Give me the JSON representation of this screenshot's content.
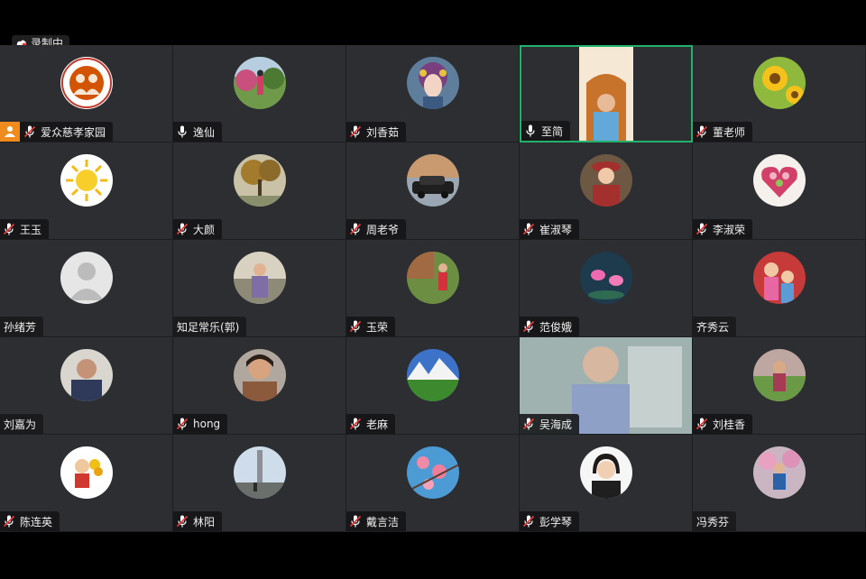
{
  "recording": {
    "label": "录制中"
  },
  "colors": {
    "tile_bg": "#2d2e31",
    "active_border": "#23b26b",
    "host_badge": "#f08c1e",
    "muted_red": "#e33b3b"
  },
  "participants": [
    {
      "name": "爱众慈孝家园",
      "mic": "muted",
      "host": true,
      "avatar": "logo"
    },
    {
      "name": "逸仙",
      "mic": "on",
      "avatar": "garden-photo"
    },
    {
      "name": "刘香茹",
      "mic": "muted",
      "avatar": "opera-mask"
    },
    {
      "name": "至简",
      "mic": "on",
      "active": true,
      "avatar": "portrait"
    },
    {
      "name": "董老师",
      "mic": "muted",
      "avatar": "sunflower"
    },
    {
      "name": "王玉",
      "mic": "muted",
      "avatar": "sun-drawing"
    },
    {
      "name": "大颜",
      "mic": "muted",
      "avatar": "autumn-tree"
    },
    {
      "name": "周老爷",
      "mic": "muted",
      "avatar": "car"
    },
    {
      "name": "崔淑琴",
      "mic": "muted",
      "avatar": "woman-hat"
    },
    {
      "name": "李淑荣",
      "mic": "muted",
      "avatar": "flower-heart"
    },
    {
      "name": "孙绪芳",
      "mic": "none",
      "avatar": "default"
    },
    {
      "name": "知足常乐(郭)",
      "mic": "none",
      "avatar": "woman-outdoor"
    },
    {
      "name": "玉荣",
      "mic": "muted",
      "avatar": "garden-woman"
    },
    {
      "name": "范俊娥",
      "mic": "muted",
      "avatar": "lotus"
    },
    {
      "name": "齐秀云",
      "mic": "none",
      "avatar": "two-kids"
    },
    {
      "name": "刘嘉为",
      "mic": "none",
      "avatar": "old-man"
    },
    {
      "name": "hong",
      "mic": "muted",
      "avatar": "woman-smile"
    },
    {
      "name": "老麻",
      "mic": "muted",
      "avatar": "mountains"
    },
    {
      "name": "吴海成",
      "mic": "muted",
      "avatar": "video"
    },
    {
      "name": "刘桂香",
      "mic": "muted",
      "avatar": "woman-field"
    },
    {
      "name": "陈连英",
      "mic": "muted",
      "avatar": "woman-flowers"
    },
    {
      "name": "林阳",
      "mic": "muted",
      "avatar": "monument"
    },
    {
      "name": "戴言洁",
      "mic": "muted",
      "avatar": "blossoms"
    },
    {
      "name": "彭学琴",
      "mic": "muted",
      "avatar": "woman-portrait"
    },
    {
      "name": "冯秀芬",
      "mic": "none",
      "avatar": "flower-tree"
    }
  ]
}
